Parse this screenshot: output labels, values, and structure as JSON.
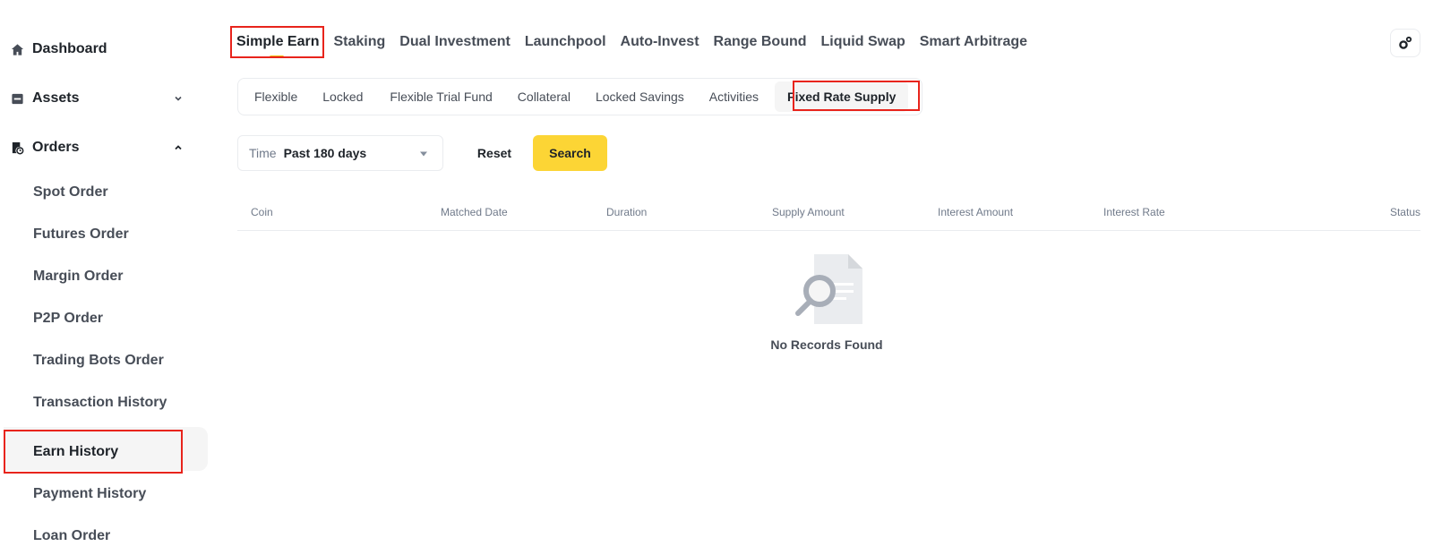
{
  "sidebar": {
    "items": [
      {
        "label": "Dashboard",
        "icon": "home-icon"
      },
      {
        "label": "Assets",
        "icon": "wallet-icon",
        "caret": "chevron-down-icon"
      },
      {
        "label": "Orders",
        "icon": "orders-icon",
        "caret": "chevron-up-icon"
      }
    ],
    "sub_items": [
      {
        "label": "Spot Order"
      },
      {
        "label": "Futures Order"
      },
      {
        "label": "Margin Order"
      },
      {
        "label": "P2P Order"
      },
      {
        "label": "Trading Bots Order"
      },
      {
        "label": "Transaction History"
      },
      {
        "label": "Earn History",
        "active": true
      },
      {
        "label": "Payment History"
      },
      {
        "label": "Loan Order"
      }
    ]
  },
  "top_tabs": [
    {
      "label": "Simple Earn",
      "active": true
    },
    {
      "label": "Staking"
    },
    {
      "label": "Dual Investment"
    },
    {
      "label": "Launchpool"
    },
    {
      "label": "Auto-Invest"
    },
    {
      "label": "Range Bound"
    },
    {
      "label": "Liquid Swap"
    },
    {
      "label": "Smart Arbitrage"
    }
  ],
  "sub_tabs": [
    {
      "label": "Flexible"
    },
    {
      "label": "Locked"
    },
    {
      "label": "Flexible Trial Fund"
    },
    {
      "label": "Collateral"
    },
    {
      "label": "Locked Savings"
    },
    {
      "label": "Activities"
    },
    {
      "label": "Fixed Rate Supply",
      "active": true
    }
  ],
  "filters": {
    "time_label": "Time",
    "time_value": "Past 180 days",
    "reset_label": "Reset",
    "search_label": "Search"
  },
  "table": {
    "columns": [
      "Coin",
      "Matched Date",
      "Duration",
      "Supply Amount",
      "Interest Amount",
      "Interest Rate",
      "Status"
    ],
    "rows": [],
    "empty_text": "No Records Found"
  },
  "colors": {
    "accent": "#fcd535",
    "highlight": "#e8241c",
    "text_primary": "#1e2329",
    "text_secondary": "#707a8a"
  }
}
